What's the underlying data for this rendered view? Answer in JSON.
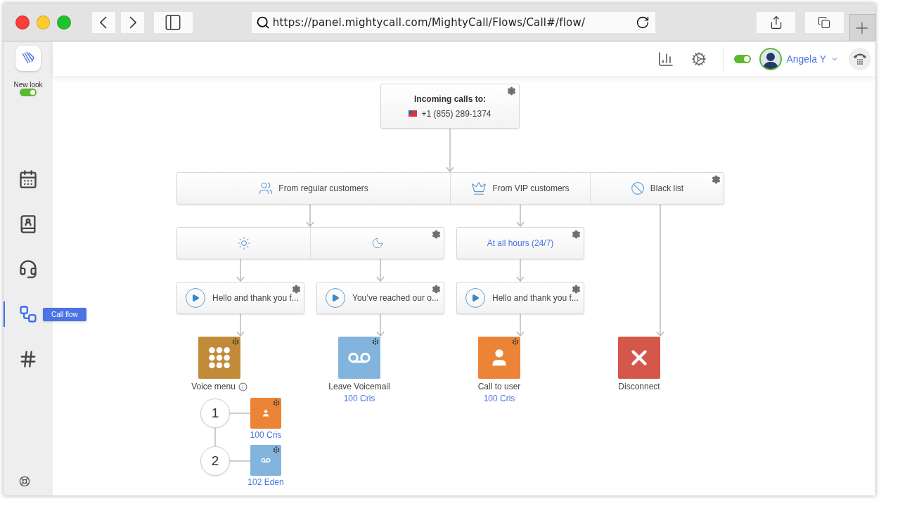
{
  "browser": {
    "url": "https://panel.mightycall.com/MightyCall/Flows/Call#/flow/"
  },
  "header": {
    "status_on": true,
    "user": "Angela Y"
  },
  "sidebar": {
    "new_look": {
      "label": "New look",
      "on": true
    },
    "items": [
      {
        "kind": "calendar",
        "selected": false
      },
      {
        "kind": "contacts",
        "selected": false
      },
      {
        "kind": "operator",
        "selected": false
      },
      {
        "kind": "callflow",
        "selected": true,
        "tooltip": "Call flow"
      },
      {
        "kind": "numbers",
        "selected": false
      }
    ]
  },
  "flow": {
    "incoming": {
      "title": "Incoming calls to:",
      "number": "+1 (855) 289-1374"
    },
    "filters": [
      {
        "kind": "regular",
        "label": "From regular customers"
      },
      {
        "kind": "vip",
        "label": "From VIP customers"
      },
      {
        "kind": "blacklist",
        "label": "Black list"
      }
    ],
    "schedules": [
      {
        "segments": [
          {
            "kind": "day"
          },
          {
            "kind": "night"
          }
        ]
      },
      {
        "segments": [
          {
            "kind": "text",
            "label": "At all hours (24/7)"
          }
        ]
      }
    ],
    "greetings": [
      "Hello and thank you f...",
      "You’ve reached our o...",
      "Hello and thank you f..."
    ],
    "actions": [
      {
        "kind": "menu",
        "color": "#c18b3a",
        "label": "Voice menu",
        "info": true
      },
      {
        "kind": "voicemail",
        "color": "#82b4de",
        "label": "Leave Voicemail",
        "target": "100 Cris"
      },
      {
        "kind": "user",
        "color": "#ec8437",
        "label": "Call to user",
        "target": "100 Cris"
      },
      {
        "kind": "disconnect",
        "color": "#d5564a",
        "label": "Disconnect"
      }
    ],
    "voice_menu": [
      {
        "key": "1",
        "kind": "user",
        "color": "#ec8437",
        "target": "100 Cris"
      },
      {
        "key": "2",
        "kind": "voicemail",
        "color": "#82b4de",
        "target": "102 Eden"
      }
    ]
  }
}
